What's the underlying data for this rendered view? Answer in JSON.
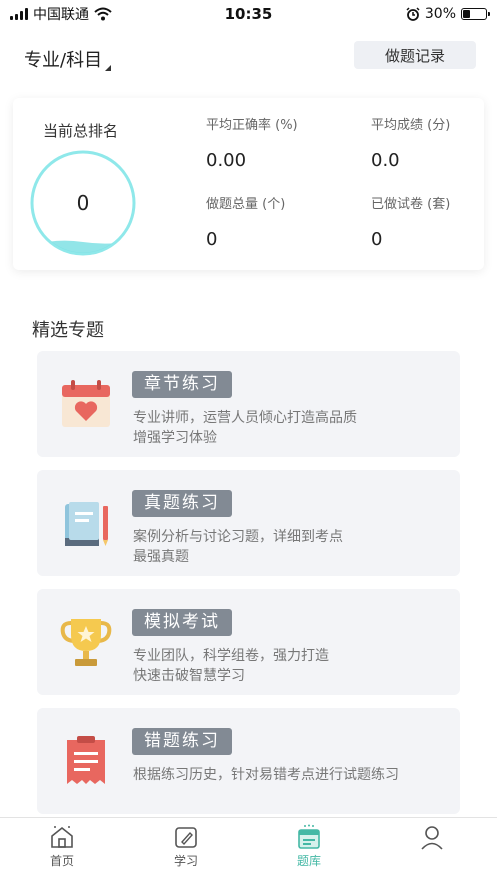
{
  "status_bar": {
    "carrier": "中国联通",
    "time": "10:35",
    "battery": "30%",
    "battery_level": 0.3
  },
  "header": {
    "subject_label": "专业/科目",
    "record_button": "做题记录"
  },
  "stats": {
    "rank_label": "当前总排名",
    "rank_value": "0",
    "avg_accuracy_label": "平均正确率 (%)",
    "avg_accuracy_value": "0.00",
    "avg_score_label": "平均成绩 (分)",
    "avg_score_value": "0.0",
    "total_questions_label": "做题总量 (个)",
    "total_questions_value": "0",
    "papers_done_label": "已做试卷 (套)",
    "papers_done_value": "0"
  },
  "section": {
    "title": "精选专题"
  },
  "features": [
    {
      "title": "章节练习",
      "desc": "专业讲师，运营人员倾心打造高品质\n 增强学习体验",
      "icon": "calendar-heart-icon"
    },
    {
      "title": "真题练习",
      "desc": "案例分析与讨论习题，详细到考点\n最强真题",
      "icon": "book-pen-icon"
    },
    {
      "title": "模拟考试",
      "desc": "专业团队，科学组卷，强力打造\n快速击破智慧学习",
      "icon": "trophy-icon"
    },
    {
      "title": "错题练习",
      "desc": "根据练习历史，针对易错考点进行试题练习",
      "icon": "clipboard-icon"
    }
  ],
  "nav": {
    "home": "首页",
    "study": "学习",
    "question_bank": "题库",
    "active": "题库",
    "active_color": "#44b8a5"
  }
}
